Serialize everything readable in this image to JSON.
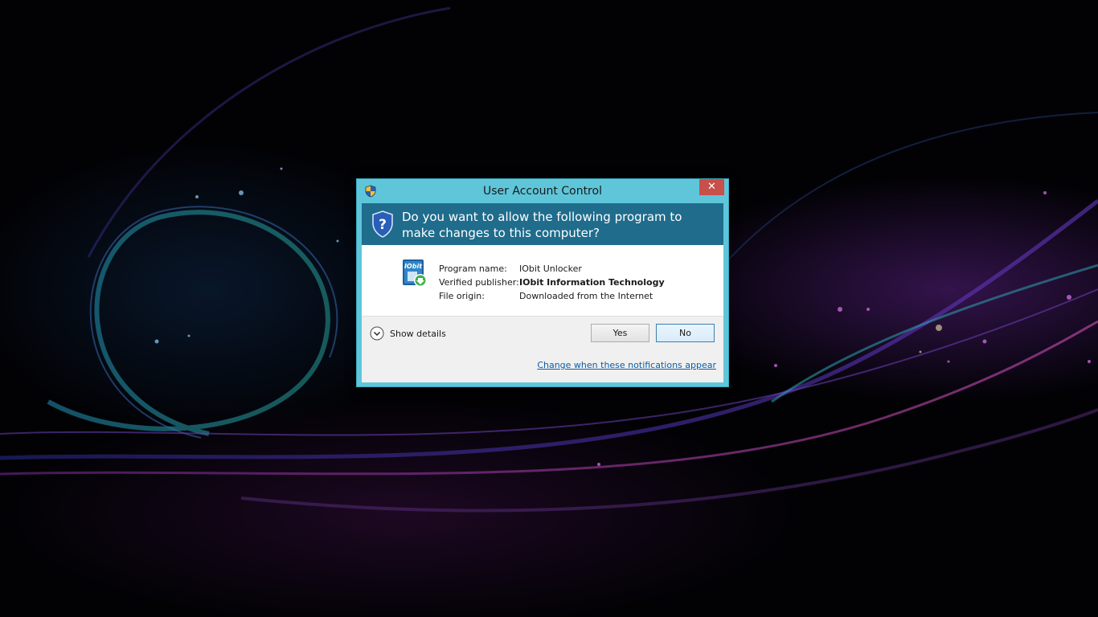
{
  "dialog": {
    "title": "User Account Control",
    "close_glyph": "✕",
    "question": "Do you want to allow the following program to make changes to this computer?",
    "program_icon_text": "IObit",
    "details": {
      "program_name_label": "Program name:",
      "program_name": "IObit Unlocker",
      "publisher_label": "Verified publisher:",
      "publisher": "IObit Information Technology",
      "origin_label": "File origin:",
      "origin": "Downloaded from the Internet"
    },
    "show_details_label": "Show details",
    "yes_label": "Yes",
    "no_label": "No",
    "change_notifications_link": "Change when these notifications appear"
  },
  "colors": {
    "window_frame": "#5fc6da",
    "banner": "#1f6c8c",
    "close_button": "#c7504a",
    "link": "#0b5ea8"
  },
  "icons": {
    "title": "uac-shield-icon",
    "banner": "question-shield-icon",
    "program": "iobit-unlocker-icon",
    "expand": "chevron-down-icon",
    "close": "close-icon"
  }
}
